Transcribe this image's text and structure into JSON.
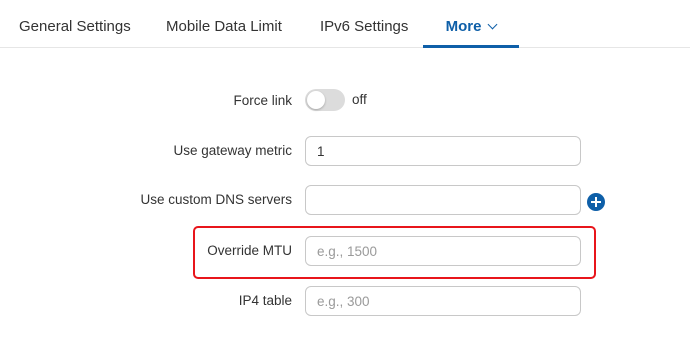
{
  "tabs": {
    "general": "General Settings",
    "mobile": "Mobile Data Limit",
    "ipv6": "IPv6 Settings",
    "more": "More"
  },
  "form": {
    "force_link": {
      "label": "Force link",
      "state": "off"
    },
    "gateway_metric": {
      "label": "Use gateway metric",
      "value": "1"
    },
    "custom_dns": {
      "label": "Use custom DNS servers",
      "value": ""
    },
    "override_mtu": {
      "label": "Override MTU",
      "placeholder": "e.g., 1500"
    },
    "ip4_table": {
      "label": "IP4 table",
      "placeholder": "e.g., 300"
    }
  },
  "colors": {
    "accent": "#0e5fa8",
    "highlight": "#e8151b",
    "toggle_off": "#dcdcdc"
  },
  "icons": {
    "more_tab": "chevron-down-icon",
    "dns_add": "plus-circle-icon"
  }
}
